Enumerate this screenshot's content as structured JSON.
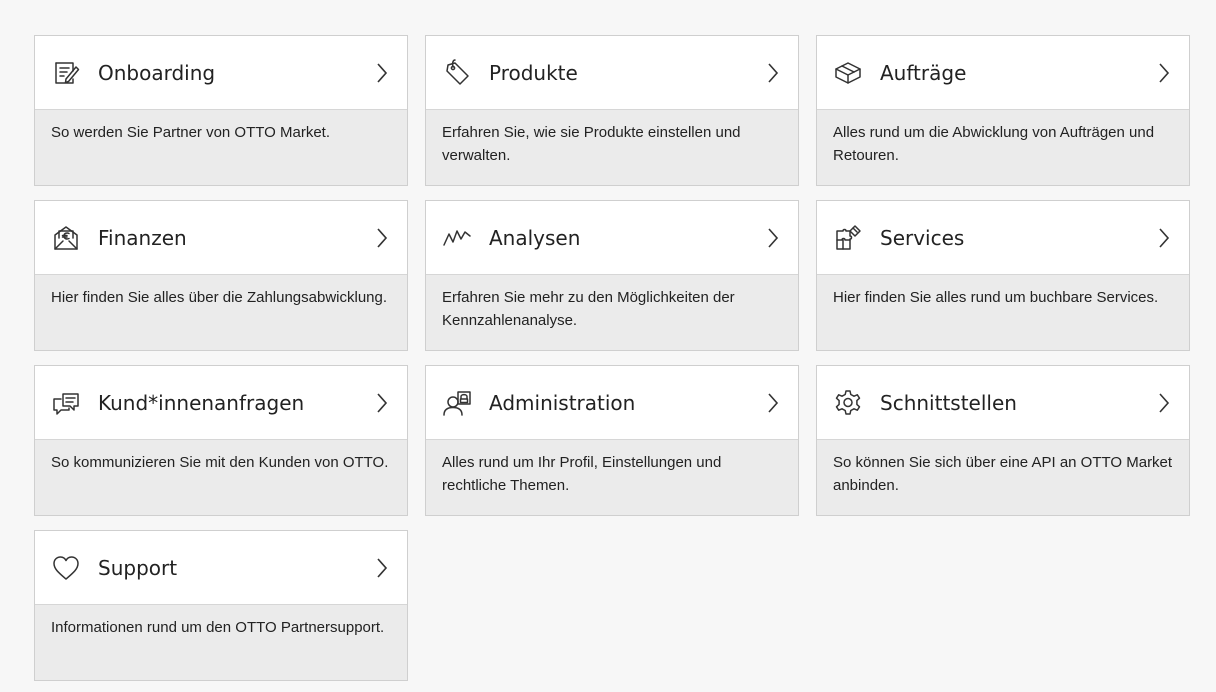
{
  "cards": [
    {
      "icon": "edit-document-icon",
      "title": "Onboarding",
      "description": "So werden Sie Partner von OTTO Market."
    },
    {
      "icon": "price-tag-icon",
      "title": "Produkte",
      "description": "Erfahren Sie, wie sie Produkte einstellen und verwalten."
    },
    {
      "icon": "package-box-icon",
      "title": "Aufträge",
      "description": "Alles rund um die Abwicklung von Aufträgen und Retouren."
    },
    {
      "icon": "money-envelope-icon",
      "title": "Finanzen",
      "description": "Hier finden Sie alles über die Zahlungsabwicklung."
    },
    {
      "icon": "analytics-line-icon",
      "title": "Analysen",
      "description": "Erfahren Sie mehr zu den Möglichkeiten der Kennzahlenanalyse."
    },
    {
      "icon": "puzzle-services-icon",
      "title": "Services",
      "description": "Hier finden Sie alles rund um buchbare Services."
    },
    {
      "icon": "chat-bubbles-icon",
      "title": "Kund*innenanfragen",
      "description": "So kommunizieren Sie mit den Kunden von OTTO."
    },
    {
      "icon": "user-lock-icon",
      "title": "Administration",
      "description": "Alles rund um Ihr Profil, Einstellungen und rechtliche Themen."
    },
    {
      "icon": "gear-icon",
      "title": "Schnittstellen",
      "description": "So können Sie sich über eine API an OTTO Market anbinden."
    },
    {
      "icon": "heart-icon",
      "title": "Support",
      "description": "Informationen rund um den OTTO Partnersupport."
    }
  ]
}
